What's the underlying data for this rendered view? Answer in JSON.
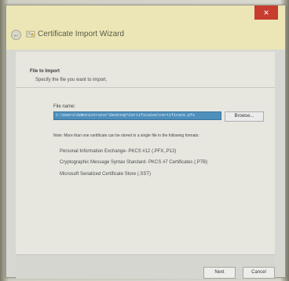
{
  "window": {
    "title": "Certificate Import Wizard",
    "close_label": "×"
  },
  "page": {
    "section_title": "File to Import",
    "section_subtitle": "Specify the file you want to import.",
    "file_label": "File name:",
    "file_value": "C:\\Users\\Administrator\\Desktop\\Certificates\\certificate.pfx",
    "browse_label": "Browse...",
    "note": "Note: More than one certificate can be stored in a single file in the following formats:",
    "formats": [
      "Personal Information Exchange- PKCS #12 (.PFX,.P12)",
      "Cryptographic Message Syntax Standard- PKCS #7 Certificates (.P7B)",
      "Microsoft Serialized Certificate Store (.SST)"
    ]
  },
  "buttons": {
    "next": "Next",
    "cancel": "Cancel"
  },
  "colors": {
    "title_bg": "#ece6b6",
    "close": "#c73d30",
    "selection": "#4f8fbb"
  },
  "icons": {
    "back": "back-arrow-icon",
    "certificate": "certificate-icon"
  }
}
